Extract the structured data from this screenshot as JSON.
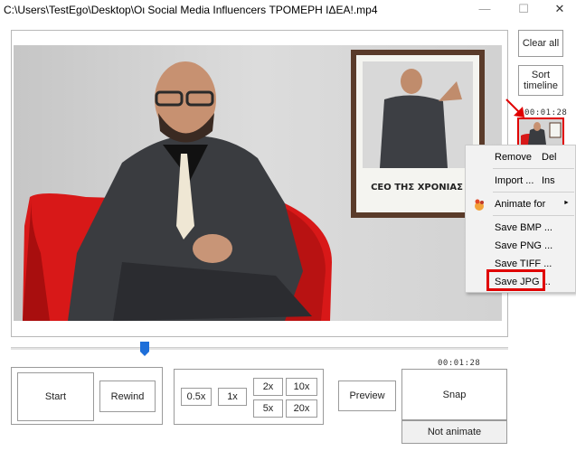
{
  "window": {
    "title": "C:\\Users\\TestEgo\\Desktop\\Οι Social Media Influencers ΤΡΟΜΕΡΗ ΙΔΕΑ!.mp4",
    "minimize_glyph": "—",
    "maximize_glyph": "☐",
    "close_glyph": "✕"
  },
  "video": {
    "poster_caption": "CEO ΤΗΣ ΧΡΟΝΙΑΣ"
  },
  "timeline_panel": {
    "clear_all_label": "Clear all",
    "sort_timeline_label": "Sort timeline",
    "thumbnail_timecode": "00:01:28"
  },
  "context_menu": {
    "items": [
      {
        "label": "Remove",
        "shortcut": "Del"
      },
      {
        "label": "Import ...",
        "shortcut": "Ins"
      },
      {
        "label": "Animate for",
        "shortcut": "",
        "icon": "animate-icon",
        "submenu_arrow": "►"
      },
      {
        "label": "Save BMP ...",
        "shortcut": ""
      },
      {
        "label": "Save PNG ...",
        "shortcut": ""
      },
      {
        "label": "Save TIFF ...",
        "shortcut": ""
      },
      {
        "label": "Save JPG ...",
        "shortcut": ""
      }
    ],
    "highlight_color": "#e00000"
  },
  "controls": {
    "start_label": "Start",
    "rewind_label": "Rewind",
    "speeds": [
      "0.5x",
      "1x",
      "2x",
      "10x",
      "5x",
      "20x"
    ],
    "preview_label": "Preview",
    "snap_timecode": "00:01:28",
    "snap_label": "Snap",
    "not_animate_label": "Not animate"
  },
  "slider": {
    "position_fraction": 0.27,
    "thumb_color": "#1e6fd9"
  },
  "accent_color": "#e00000"
}
